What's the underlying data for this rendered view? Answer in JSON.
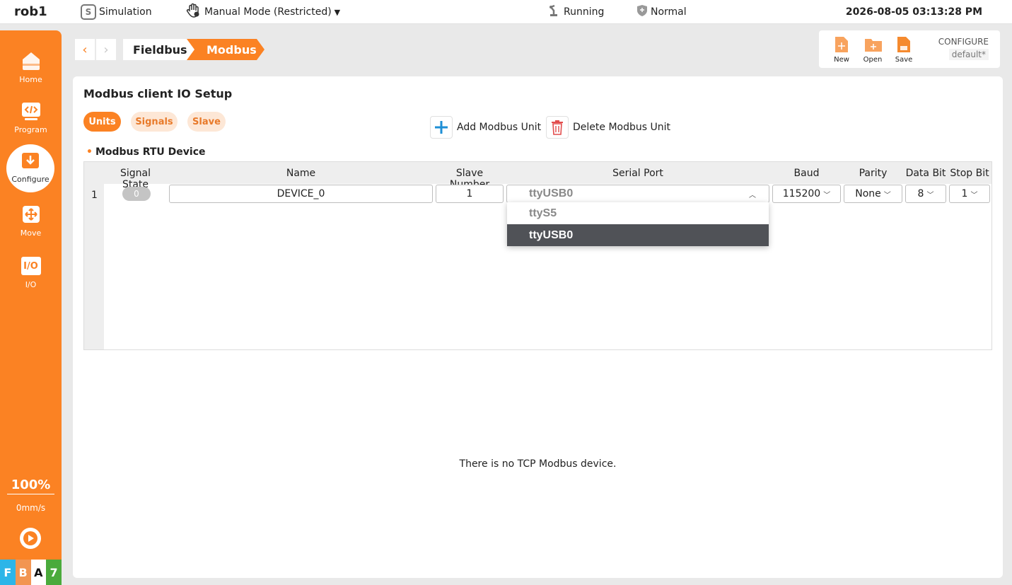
{
  "topbar": {
    "robot": "rob1",
    "simulation": "Simulation",
    "sim_icon_letter": "S",
    "mode": "Manual Mode (Restricted)",
    "status": "Running",
    "safety": "Normal",
    "datetime": "2026-08-05 03:13:28 PM"
  },
  "sidebar": {
    "items": [
      {
        "label": "Home",
        "icon": "home-icon"
      },
      {
        "label": "Program",
        "icon": "code-icon"
      },
      {
        "label": "Configure",
        "icon": "configure-icon"
      },
      {
        "label": "Move",
        "icon": "move-icon"
      },
      {
        "label": "I/O",
        "icon": "io-icon"
      }
    ],
    "io_icon_text": "I/O",
    "speed_percent": "100%",
    "speed_mm": "0mm/s",
    "badges": [
      "F",
      "B",
      "A",
      "7"
    ]
  },
  "breadcrumb": {
    "items": [
      "Fieldbus",
      "Modbus"
    ]
  },
  "filetools": {
    "new_label": "New",
    "open_label": "Open",
    "save_label": "Save",
    "config_title": "CONFIGURE",
    "config_name": "default*"
  },
  "page": {
    "title": "Modbus client IO Setup",
    "tabs": [
      "Units",
      "Signals",
      "Slave"
    ],
    "add_label": "Add Modbus Unit",
    "delete_label": "Delete Modbus Unit",
    "section": "Modbus RTU Device",
    "empty_tcp": "There is no TCP Modbus device."
  },
  "table": {
    "headers": [
      "Signal State",
      "Name",
      "Slave Number",
      "Serial Port",
      "Baud",
      "Parity",
      "Data Bit",
      "Stop Bit"
    ],
    "row": {
      "index": "1",
      "state": "0",
      "name": "DEVICE_0",
      "slave_number": "1",
      "serial_port": "ttyUSB0",
      "baud": "115200",
      "parity": "None",
      "data_bit": "8",
      "stop_bit": "1"
    }
  },
  "dropdown": {
    "options": [
      "ttyS5",
      "ttyUSB0"
    ],
    "selected": "ttyUSB0"
  },
  "colors": {
    "accent": "#fb8223",
    "badge_f": "#2cb5e8",
    "badge_b": "#f29552",
    "badge_a": "#ffffff",
    "badge_7": "#4aaa3c"
  }
}
